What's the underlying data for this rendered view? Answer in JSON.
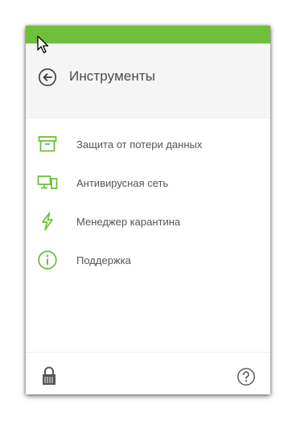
{
  "colors": {
    "accent": "#6fbf3a",
    "header_bg": "#f5f5f5",
    "text": "#555555",
    "icon_dark": "#555555"
  },
  "header": {
    "title": "Инструменты",
    "back_icon": "back-arrow-circle-icon"
  },
  "menu": {
    "items": [
      {
        "label": "Защита от потери данных",
        "icon": "archive-box-icon"
      },
      {
        "label": "Антивирусная сеть",
        "icon": "network-computers-icon"
      },
      {
        "label": "Менеджер карантина",
        "icon": "lightning-bolt-icon"
      },
      {
        "label": "Поддержка",
        "icon": "info-circle-icon"
      }
    ]
  },
  "footer": {
    "lock_icon": "padlock-icon",
    "help_icon": "help-question-icon"
  }
}
